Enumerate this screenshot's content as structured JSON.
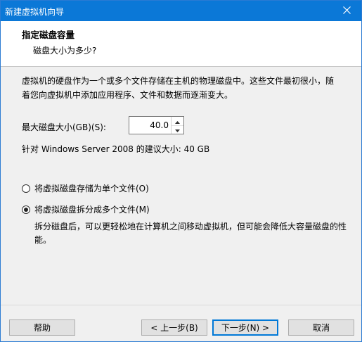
{
  "window": {
    "title": "新建虚拟机向导"
  },
  "header": {
    "title": "指定磁盘容量",
    "subtitle": "磁盘大小为多少?"
  },
  "body": {
    "description": "虚拟机的硬盘作为一个或多个文件存储在主机的物理磁盘中。这些文件最初很小，随着您向虚拟机中添加应用程序、文件和数据而逐渐变大。",
    "max_size_label": "最大磁盘大小(GB)(S):",
    "max_size_value": "40.0",
    "recommendation": "针对 Windows Server 2008 的建议大小: 40 GB",
    "options": [
      {
        "label": "将虚拟磁盘存储为单个文件(O)",
        "selected": false
      },
      {
        "label": "将虚拟磁盘拆分成多个文件(M)",
        "selected": true
      }
    ],
    "split_description": "拆分磁盘后，可以更轻松地在计算机之间移动虚拟机，但可能会降低大容量磁盘的性能。"
  },
  "footer": {
    "help_label": "帮助",
    "prev_label": "< 上一步(B)",
    "next_label": "下一步(N) >",
    "cancel_label": "取消"
  },
  "colors": {
    "titlebar": "#0b78d7",
    "accent": "#0078d7"
  },
  "icons": {
    "close": "close-icon",
    "spin_up": "arrow-up-icon",
    "spin_down": "arrow-down-icon"
  }
}
